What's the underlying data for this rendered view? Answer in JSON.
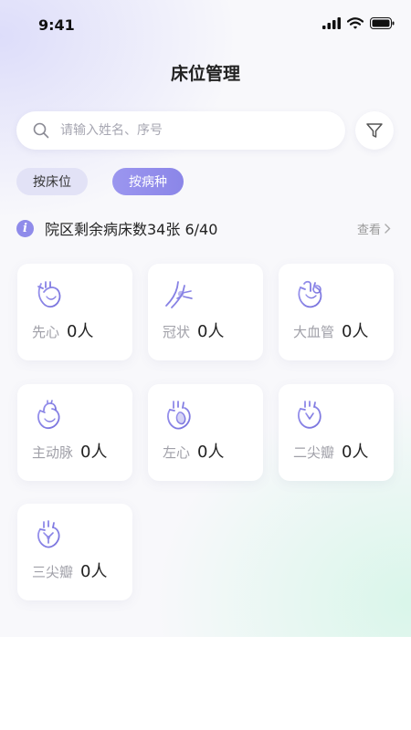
{
  "status_bar": {
    "time": "9:41"
  },
  "header": {
    "title": "床位管理"
  },
  "search": {
    "placeholder": "请输入姓名、序号"
  },
  "tabs": [
    {
      "label": "按床位",
      "active": false
    },
    {
      "label": "按病种",
      "active": true
    }
  ],
  "summary": {
    "icon": "i",
    "text": "院区剩余病床数34张 6/40",
    "link": "查看"
  },
  "cards": [
    {
      "name": "先心",
      "count": "0人",
      "icon": "heart-icon"
    },
    {
      "name": "冠状",
      "count": "0人",
      "icon": "coronary-artery-icon"
    },
    {
      "name": "大血管",
      "count": "0人",
      "icon": "great-vessels-heart-icon"
    },
    {
      "name": "主动脉",
      "count": "0人",
      "icon": "aorta-heart-icon"
    },
    {
      "name": "左心",
      "count": "0人",
      "icon": "left-heart-icon"
    },
    {
      "name": "二尖瓣",
      "count": "0人",
      "icon": "mitral-valve-icon"
    },
    {
      "name": "三尖瓣",
      "count": "0人",
      "icon": "tricuspid-valve-icon"
    }
  ],
  "colors": {
    "accent": "#8f8bea",
    "tab_inactive": "#e2e2f6",
    "text": "#222222",
    "muted": "#a0a0a8"
  }
}
